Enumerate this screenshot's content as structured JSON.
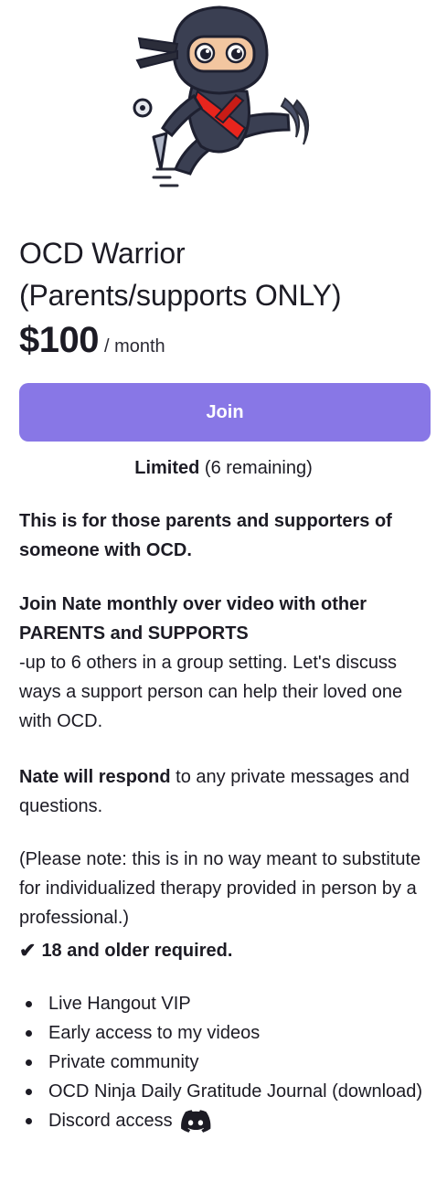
{
  "tier": {
    "title_line1": "OCD Warrior",
    "title_line2": "(Parents/supports ONLY)",
    "price": "$100",
    "period": "/ month",
    "join_label": "Join",
    "limited_label": "Limited",
    "remaining_text": " (6 remaining)"
  },
  "description": {
    "p1": "This is for those parents and supporters of someone with OCD.",
    "p2_bold": "Join Nate monthly over video with other PARENTS and SUPPORTS",
    "p2_text": "-up to 6 others in a group setting. Let's discuss ways a support person can help their loved one with OCD.",
    "p3_bold": "Nate will respond",
    "p3_text": " to any private messages and questions.",
    "p4": "(Please note: this is in no way meant to substitute for individualized therapy provided in person by a professional.)",
    "check_mark": "✔",
    "age_requirement": "18 and older required."
  },
  "benefits": [
    "Live Hangout VIP",
    "Early access to my videos",
    "Private community",
    "OCD Ninja Daily Gratitude Journal (download)",
    "Discord access"
  ],
  "colors": {
    "join_button": "#8877e6",
    "text": "#1c1b24",
    "ninja_sash": "#e8251d",
    "discord_icon": "#1c1b24"
  },
  "icons": {
    "mascot": "ninja-mascot-icon",
    "discord": "discord-icon"
  }
}
